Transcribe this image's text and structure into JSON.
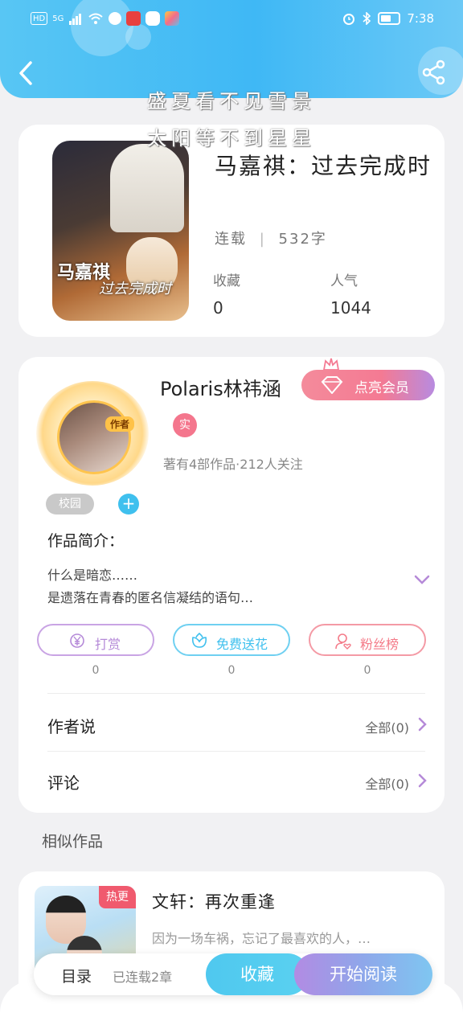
{
  "status_bar": {
    "carrier": "HD",
    "network": "5G",
    "time": "7:38"
  },
  "overlay": {
    "line1": "盛夏看不见雪景",
    "line2": "太阳等不到星星"
  },
  "book": {
    "title": "马嘉祺：过去完成时",
    "status": "连载",
    "word_count": "532字",
    "cover_text1": "马嘉祺",
    "cover_text2": "过去完成时",
    "stats": [
      {
        "label": "收藏",
        "value": "0"
      },
      {
        "label": "人气",
        "value": "1044"
      }
    ]
  },
  "author": {
    "name": "Polaris林祎涵",
    "avatar_badge": "作者",
    "vip_button": "点亮会员",
    "real_badge": "实",
    "summary": "著有4部作品·212人关注",
    "tags": [
      "校园"
    ],
    "intro_title": "作品简介：",
    "intro_lines": [
      "什么是暗恋……",
      "是遗落在青春的匿名信凝结的语句…"
    ]
  },
  "actions": [
    {
      "label": "打赏",
      "count": "0",
      "color": "#b58ad8",
      "icon": "yen-coin-icon"
    },
    {
      "label": "免费送花",
      "count": "0",
      "color": "#3fc0ee",
      "icon": "flower-icon"
    },
    {
      "label": "粉丝榜",
      "count": "0",
      "color": "#f47a88",
      "icon": "fan-user-icon"
    }
  ],
  "rows": [
    {
      "label": "作者说",
      "right": "全部(0)"
    },
    {
      "label": "评论",
      "right": "全部(0)"
    }
  ],
  "similar": {
    "section_title": "相似作品",
    "items": [
      {
        "title": "文轩：再次重逢",
        "desc": "因为一场车祸，忘记了最喜欢的人，…",
        "badge": "热更"
      }
    ]
  },
  "read_bar": {
    "toc": "目录",
    "toc_sub": "已连载2章",
    "favorite": "收藏",
    "start_read": "开始阅读"
  },
  "colors": {
    "header": "#3fb8f5",
    "accent_blue": "#3fc0ee",
    "accent_pink": "#f47a93",
    "accent_purple": "#b28be3"
  }
}
